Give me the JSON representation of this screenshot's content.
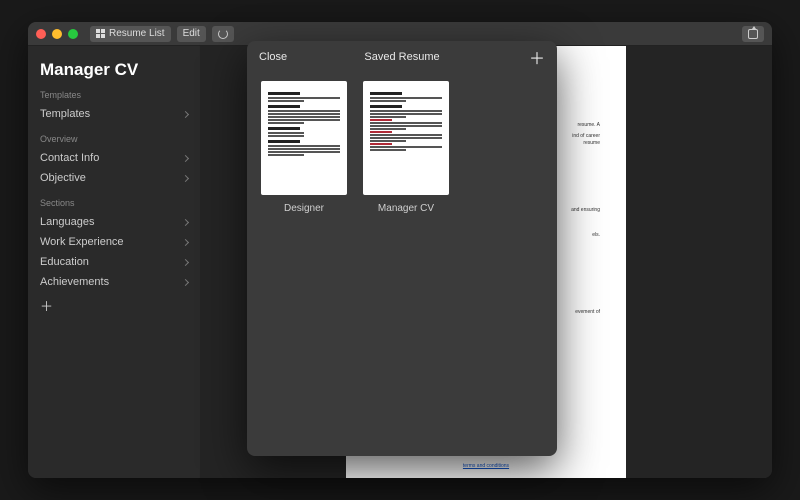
{
  "titlebar": {
    "resume_list_label": "Resume List",
    "edit_label": "Edit"
  },
  "sidebar": {
    "doc_title": "Manager CV",
    "groups": {
      "templates": {
        "label": "Templates",
        "items": [
          "Templates"
        ]
      },
      "overview": {
        "label": "Overview",
        "items": [
          "Contact Info",
          "Objective"
        ]
      },
      "sections": {
        "label": "Sections",
        "items": [
          "Languages",
          "Work Experience",
          "Education",
          "Achievements"
        ]
      }
    }
  },
  "document": {
    "snippet1": "resume. A",
    "snippet2": "ind of career",
    "snippet3": "resume",
    "snippet4": "and ensuring",
    "snippet5": "els.",
    "snippet6": "evement of",
    "terms": "terms and conditions"
  },
  "modal": {
    "close_label": "Close",
    "title": "Saved Resume",
    "items": [
      {
        "label": "Designer"
      },
      {
        "label": "Manager CV"
      }
    ]
  }
}
